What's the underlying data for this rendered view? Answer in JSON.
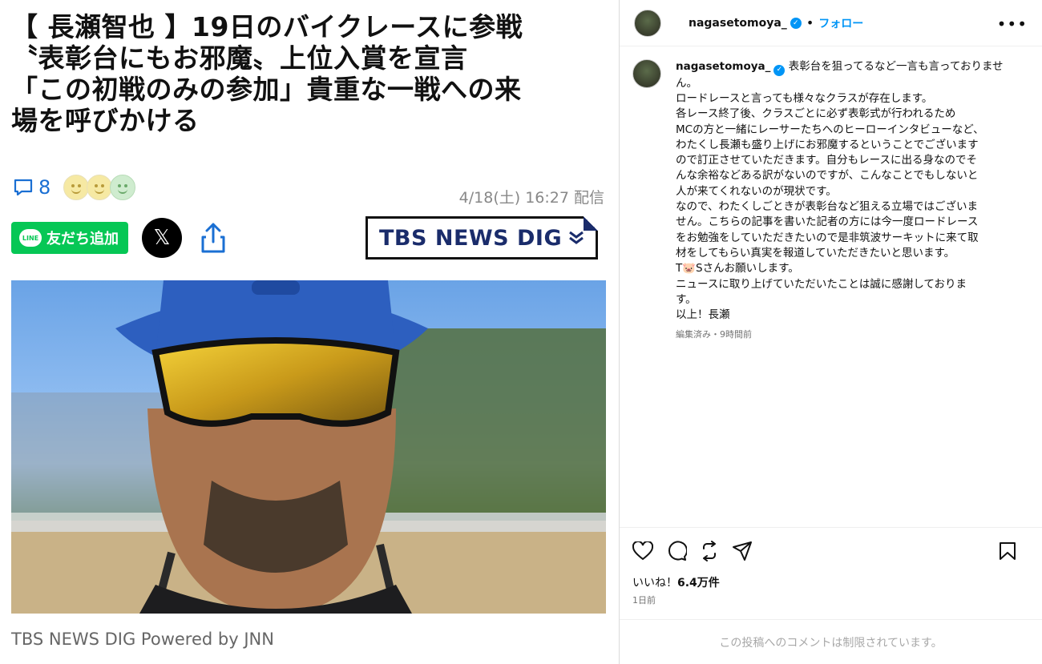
{
  "article": {
    "headline_lines": [
      "【 長瀬智也 】19日のバイクレースに参戦",
      "〝表彰台にもお邪魔〟上位入賞を宣言",
      "「この初戦のみの参加」貴重な一戦への来",
      "場を呼びかける"
    ],
    "comment_count": "8",
    "date": "4/18(土) 16:27 配信",
    "line_button": "友だち追加",
    "line_logo": "LINE",
    "x_label": "𝕏",
    "publisher_logo": "TBS NEWS DIG",
    "credit": "TBS NEWS DIG Powered by JNN"
  },
  "instagram": {
    "username": "nagasetomoya_",
    "follow": "フォロー",
    "more": "•••",
    "caption_user": "nagasetomoya_",
    "caption_lines": [
      "表彰台を狙ってるなど一言も言っておりませ",
      "ん。",
      "ロードレースと言っても様々なクラスが存在します。",
      "各レース終了後、クラスごとに必ず表彰式が行われるため",
      "MCの方と一緒にレーサーたちへのヒーローインタビューなど、",
      "わたくし長瀬も盛り上げにお邪魔するということでございます",
      "ので訂正させていただきます。自分もレースに出る身なのでそ",
      "んな余裕などある訳がないのですが、こんなことでもしないと",
      "人が来てくれないのが現状です。",
      "なので、わたくしごときが表彰台など狙える立場ではございま",
      "せん。こちらの記事を書いた記者の方には今一度ロードレース",
      "をお勉強をしていただきたいので是非筑波サーキットに来て取",
      "材をしてもらい真実を報道していただきたいと思います。",
      "T🐷Sさんお願いします。",
      "ニュースに取り上げていただいたことは誠に感謝しておりま",
      "す。",
      "以上！長瀬"
    ],
    "edited": "編集済み・9時間前",
    "likes_prefix": "いいね！",
    "likes_count": "6.4万件",
    "posted_ago": "1日前",
    "comments_disabled": "この投稿へのコメントは制限されています。"
  },
  "colors": {
    "line_green": "#06c755",
    "ig_blue": "#0095f6",
    "comment_blue": "#1a6fd3",
    "tbs_navy": "#1a2c6b"
  }
}
